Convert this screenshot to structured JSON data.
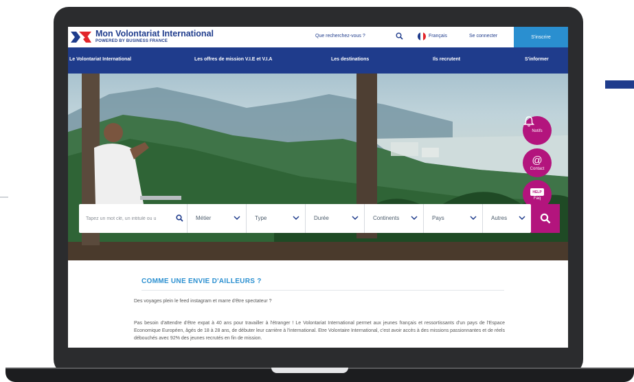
{
  "brand": {
    "title": "Mon Volontariat International",
    "subtitle": "POWERED BY BUSINESS FRANCE"
  },
  "topbar": {
    "search_prompt": "Que recherchez-vous ?",
    "language": "Français",
    "login": "Se connecter",
    "signup": "S'inscrire"
  },
  "nav": {
    "items": [
      {
        "label": "Le Volontariat International"
      },
      {
        "label": "Les offres de mission V.I.E et V.I.A"
      },
      {
        "label": "Les destinations"
      },
      {
        "label": "Ils recrutent"
      },
      {
        "label": "S'informer"
      }
    ]
  },
  "floating": {
    "notifs": "Notifs",
    "contact": "Contact",
    "help_badge": "HELP",
    "faq": "Faq"
  },
  "search": {
    "placeholder": "Tapez un mot clé, un intitulé ou u",
    "filters": [
      {
        "label": "Métier"
      },
      {
        "label": "Type"
      },
      {
        "label": "Durée"
      },
      {
        "label": "Continents"
      },
      {
        "label": "Pays"
      },
      {
        "label": "Autres"
      }
    ]
  },
  "content": {
    "title": "COMME UNE ENVIE D'AILLEURS ?",
    "intro": "Des voyages plein le feed instagram et marre d'être spectateur ?",
    "body": "Pas besoin d'attendre d'être expat à 40 ans pour travailler à l'étranger ! Le Volontariat International permet aux jeunes français et ressortissants d'un pays de l'Espace Economique Européen, âgés de 18 à 28 ans, de débuter leur carrière à l'international. Etre Volontaire International, c'est avoir accès à des missions passionnantes et de réels débouchés avec 92% des jeunes recrutés en fin de mission."
  },
  "colors": {
    "navy": "#1f3c8c",
    "accent_blue": "#2a8fd0",
    "magenta": "#b3147d",
    "logo_red": "#e2252b"
  }
}
